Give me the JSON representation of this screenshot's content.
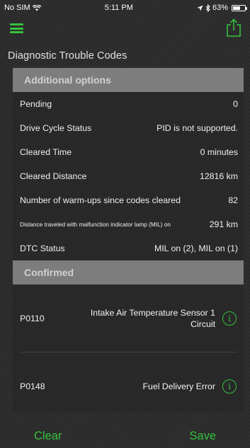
{
  "status_bar": {
    "carrier": "No SIM",
    "time": "5:11 PM",
    "battery_percent": "63%",
    "battery_level": 0.63
  },
  "nav": {
    "menu_icon": "hamburger-menu-icon",
    "share_icon": "share-export-icon",
    "accent_color": "#35c23e"
  },
  "page_title": "Diagnostic Trouble Codes",
  "sections": {
    "additional_options": {
      "title": "Additional options",
      "rows": [
        {
          "label": "Pending",
          "value": "0"
        },
        {
          "label": "Drive Cycle Status",
          "value": "PID is not supported."
        },
        {
          "label": "Cleared Time",
          "value": "0 minutes"
        },
        {
          "label": "Cleared Distance",
          "value": "12816 km"
        },
        {
          "label": "Number of warm-ups since codes cleared",
          "value": "82"
        },
        {
          "label": "Distance traveled with malfunction indicator lamp (MIL) on",
          "value": "291 km"
        },
        {
          "label": "DTC Status",
          "value": "MIL on (2), MIL on (1)"
        }
      ]
    },
    "confirmed": {
      "title": "Confirmed",
      "codes": [
        {
          "code": "P0110",
          "description": "Intake Air Temperature Sensor 1 Circuit"
        },
        {
          "code": "P0148",
          "description": "Fuel Delivery Error"
        }
      ]
    }
  },
  "bottom_bar": {
    "clear_label": "Clear",
    "save_label": "Save"
  }
}
